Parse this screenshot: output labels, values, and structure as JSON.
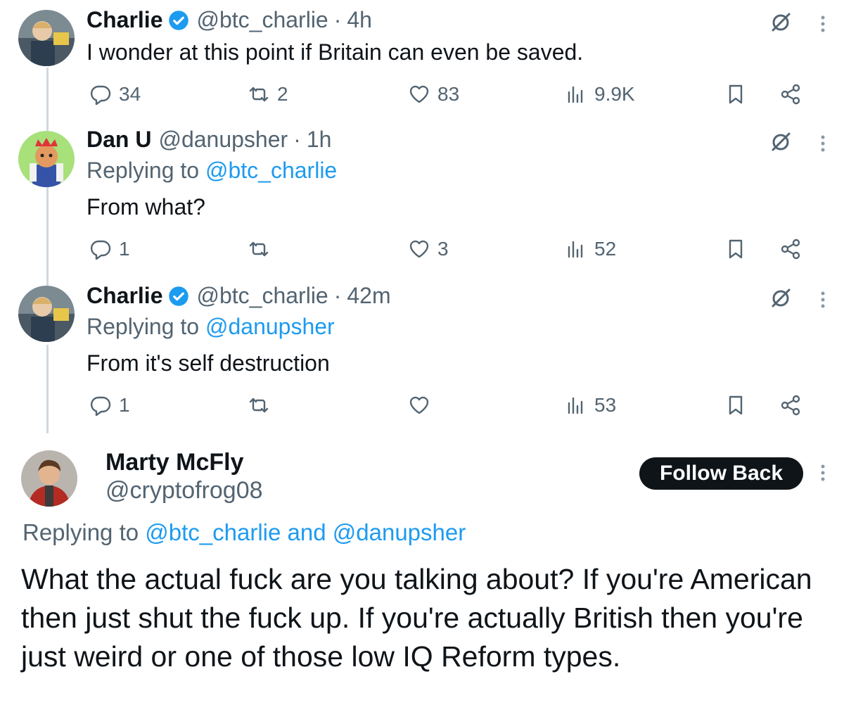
{
  "colors": {
    "text": "#0f1419",
    "secondary": "#536471",
    "link": "#1d9bf0",
    "verified": "#1d9bf0",
    "button_bg": "#0f1419"
  },
  "tweets": [
    {
      "name": "Charlie",
      "verified": true,
      "handle": "@btc_charlie",
      "sep": "·",
      "time": "4h",
      "replying_prefix": "",
      "replying_to": "",
      "text": "I wonder at this point if Britain can even be saved.",
      "replies": "34",
      "retweets": "2",
      "likes": "83",
      "views": "9.9K"
    },
    {
      "name": "Dan U",
      "verified": false,
      "handle": "@danupsher",
      "sep": "·",
      "time": "1h",
      "replying_prefix": "Replying to",
      "replying_to": "@btc_charlie",
      "text": "From what?",
      "replies": "1",
      "retweets": "",
      "likes": "3",
      "views": "52"
    },
    {
      "name": "Charlie",
      "verified": true,
      "handle": "@btc_charlie",
      "sep": "·",
      "time": "42m",
      "replying_prefix": "Replying to",
      "replying_to": "@danupsher",
      "text": "From it's self destruction",
      "replies": "1",
      "retweets": "",
      "likes": "",
      "views": "53"
    }
  ],
  "main": {
    "name": "Marty McFly",
    "handle": "@cryptofrog08",
    "follow_label": "Follow Back",
    "replying_prefix": "Replying to",
    "replying_to": "@btc_charlie and @danupsher",
    "text": "What the actual fuck are you talking about? If you're American then just shut the fuck up. If you're actually British then you're just weird or one of those low IQ Reform types."
  }
}
